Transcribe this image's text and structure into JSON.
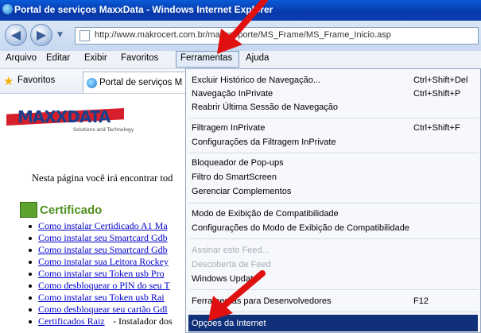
{
  "window": {
    "title": "Portal de serviços MaxxData - Windows Internet Explorer"
  },
  "address_bar": {
    "url": "http://www.makrocert.com.br/maxxsuporte/MS_Frame/MS_Frame_Inicio.asp"
  },
  "menu": {
    "items": [
      "Arquivo",
      "Editar",
      "Exibir",
      "Favoritos",
      "Ferramentas",
      "Ajuda"
    ],
    "open": "Ferramentas"
  },
  "favorites_bar": {
    "favorites_label": "Favoritos",
    "tab_title": "Portal de serviços M"
  },
  "page": {
    "intro_text": "Nesta página você irá encontrar tod",
    "section_title": "Certificado",
    "links": [
      "Como instalar Certidicado A1 Ma",
      "Como instalar seu Smartcard Gdb",
      "Como instalar seu Smartcard Gdb",
      "Como instalar sua Leitora Rockey",
      "Como instalar seu Token usb Pro",
      "Como desbloquear o PIN do seu T",
      "Como instalar seu Token usb Rai",
      "Como desbloquear seu cartão Gdl"
    ],
    "last_item_link": "Certificados Raiz",
    "last_item_text": " - Instalador dos"
  },
  "dropdown": {
    "items": [
      {
        "label": "Excluir Histórico de Navegação...",
        "shortcut": "Ctrl+Shift+Del",
        "disabled": false
      },
      {
        "label": "Navegação InPrivate",
        "shortcut": "Ctrl+Shift+P",
        "disabled": false
      },
      {
        "label": "Reabrir Última Sessão de Navegação",
        "shortcut": "",
        "disabled": false
      },
      {
        "label": "Filtragem InPrivate",
        "shortcut": "Ctrl+Shift+F",
        "disabled": false
      },
      {
        "label": "Configurações da Filtragem InPrivate",
        "shortcut": "",
        "disabled": false
      },
      {
        "label": "Bloqueador de Pop-ups",
        "shortcut": "",
        "disabled": false
      },
      {
        "label": "Filtro do SmartScreen",
        "shortcut": "",
        "disabled": false
      },
      {
        "label": "Gerenciar Complementos",
        "shortcut": "",
        "disabled": false
      },
      {
        "label": "Modo de Exibição de Compatibilidade",
        "shortcut": "",
        "disabled": false
      },
      {
        "label": "Configurações do Modo de Exibição de Compatibilidade",
        "shortcut": "",
        "disabled": false
      },
      {
        "label": "Assinar este Feed...",
        "shortcut": "",
        "disabled": true
      },
      {
        "label": "Descoberta de Feed",
        "shortcut": "",
        "disabled": true
      },
      {
        "label": "Windows Update",
        "shortcut": "",
        "disabled": false
      },
      {
        "label": "Ferramentas para Desenvolvedores",
        "shortcut": "F12",
        "disabled": false
      },
      {
        "label": "Opções da Internet",
        "shortcut": "",
        "disabled": false,
        "highlighted": true
      }
    ]
  },
  "colors": {
    "titlebar": "#0838a8",
    "highlight": "#10307a",
    "annotation_arrow": "#e01010",
    "link": "#0000cc"
  }
}
